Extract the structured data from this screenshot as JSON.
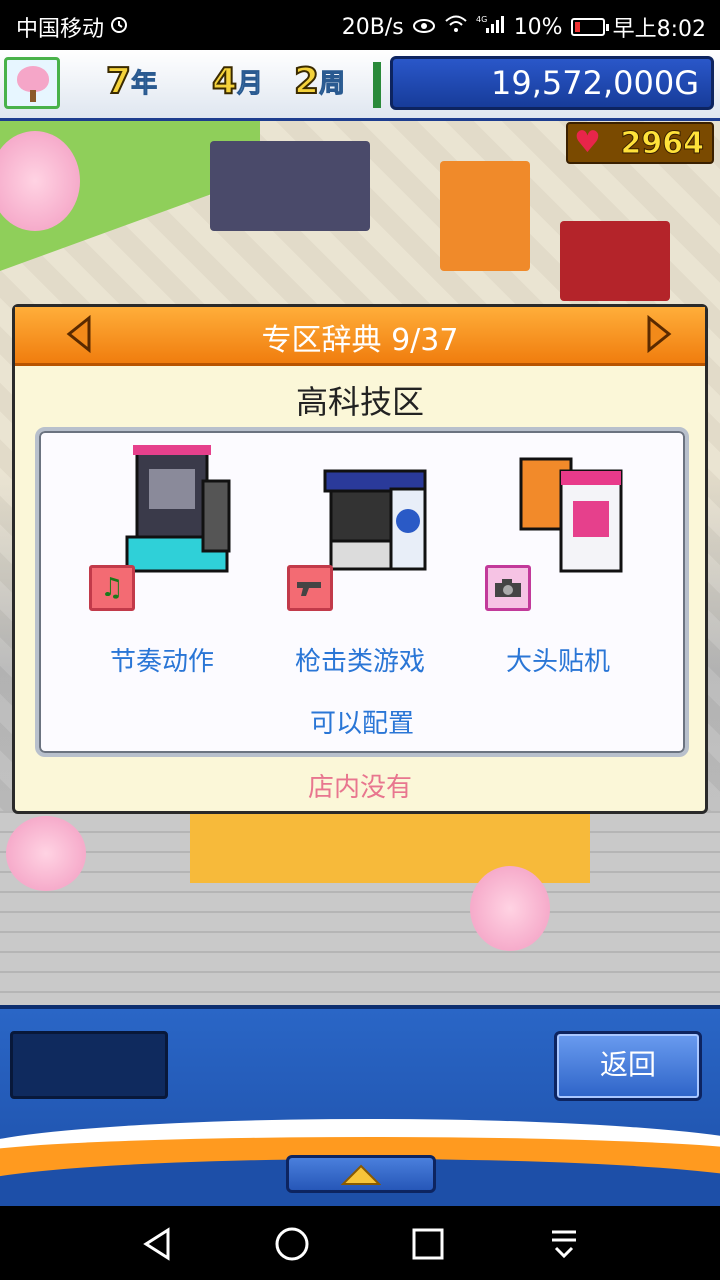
{
  "status_bar": {
    "carrier": "中国移动",
    "alarm_icon": "alarm-clock-icon",
    "net_speed": "20B/s",
    "network_type": "4G",
    "battery": "10%",
    "time": "早上8:02"
  },
  "top_bar": {
    "year_num": "7",
    "year_unit": "年",
    "month_num": "4",
    "month_unit": "月",
    "week_num": "2",
    "week_unit": "周",
    "money": "19,572,000G"
  },
  "game": {
    "hearts": "2964"
  },
  "dialog": {
    "title": "专区辞典 9/37",
    "zone_name": "高科技区",
    "facilities": [
      {
        "label": "节奏动作",
        "icon": "music-note-icon"
      },
      {
        "label": "枪击类游戏",
        "icon": "pistol-icon"
      },
      {
        "label": "大头贴机",
        "icon": "camera-icon"
      }
    ],
    "configurable": "可以配置",
    "status": "店内没有"
  },
  "bottom": {
    "back_label": "返回"
  },
  "colors": {
    "accent_orange": "#f07d0e",
    "link_blue": "#2a76d6",
    "status_pink": "#e8768f",
    "panel_blue": "#1d4fa8"
  }
}
